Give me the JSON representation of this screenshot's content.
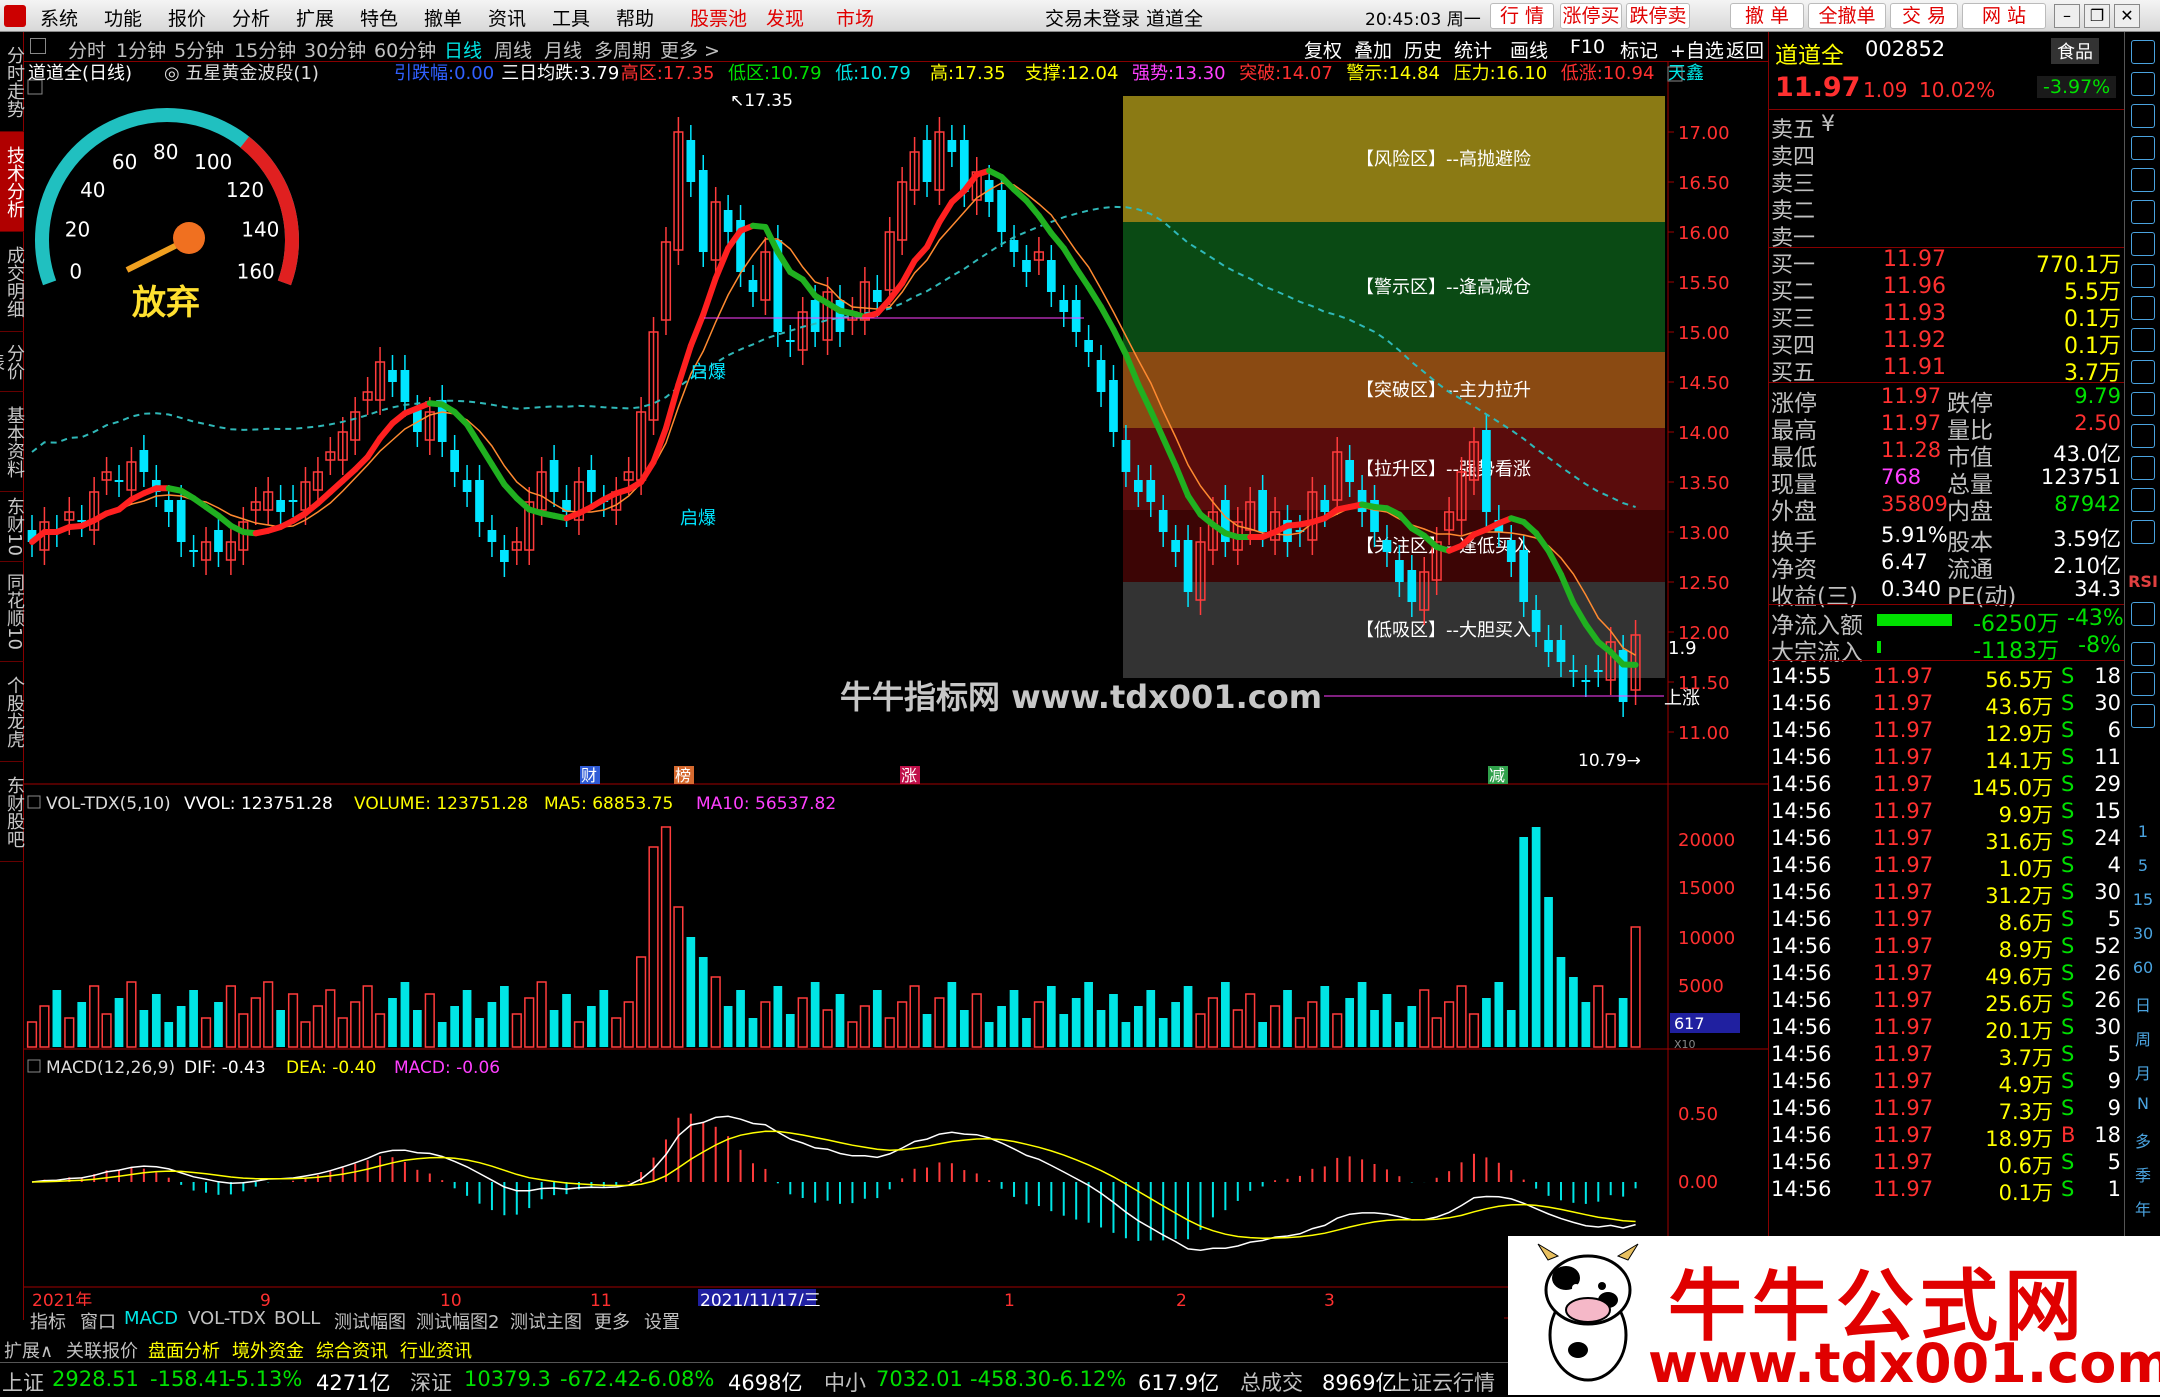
{
  "menu": {
    "items": [
      "系统",
      "功能",
      "报价",
      "分析",
      "扩展",
      "特色",
      "撤单",
      "资讯",
      "工具",
      "帮助"
    ],
    "red_items": [
      "股票池",
      "发现",
      "市场"
    ],
    "title": "交易未登录  道道全",
    "clock": "20:45:03 周一",
    "right_buttons": [
      "行 情",
      "涨停买",
      "跌停卖",
      "撤 单",
      "全撤单",
      "交 易",
      "网 站"
    ]
  },
  "side_tabs": [
    "分时走势",
    "技术分析",
    "成交明细",
    "分价表",
    "基本资料",
    "东财10",
    "同花顺10",
    "个股龙虎",
    "东财股吧"
  ],
  "period_bar": {
    "periods": [
      "分时",
      "1分钟",
      "5分钟",
      "15分钟",
      "30分钟",
      "60分钟",
      "日线",
      "周线",
      "月线",
      "多周期",
      "更多 >"
    ],
    "selected": "日线",
    "tools": [
      "复权",
      "叠加",
      "历史",
      "统计",
      "画线",
      "F10",
      "标记",
      "+自选",
      "返回"
    ]
  },
  "main_indicator": {
    "stock": "道道全(日线)",
    "formula": "五星黄金波段(1)",
    "values": [
      {
        "label": "引跌幅:",
        "value": "0.00",
        "color": "#3060ff"
      },
      {
        "label": "三日均跌:",
        "value": "3.79",
        "color": "#ffffff"
      },
      {
        "label": "高区:",
        "value": "17.35",
        "color": "#ff3030"
      },
      {
        "label": "低区:",
        "value": "10.79",
        "color": "#00e000"
      },
      {
        "label": "低:",
        "value": "10.79",
        "color": "#00e5e5"
      },
      {
        "label": "高:",
        "value": "17.35",
        "color": "#ffff00"
      },
      {
        "label": "支撑:",
        "value": "12.04",
        "color": "#ffff00"
      },
      {
        "label": "强势:",
        "value": "13.30",
        "color": "#ff40ff"
      },
      {
        "label": "突破:",
        "value": "14.07",
        "color": "#ff3030"
      },
      {
        "label": "警示:",
        "value": "14.84",
        "color": "#ffff00"
      },
      {
        "label": "压力:",
        "value": "16.10",
        "color": "#ffff00"
      },
      {
        "label": "低涨:",
        "value": "10.94",
        "color": "#ff3030"
      },
      {
        "label": "天鑫",
        "value": "",
        "color": "#00e5e5"
      }
    ]
  },
  "gauge": {
    "ticks": [
      "0",
      "20",
      "40",
      "60",
      "80",
      "100",
      "120",
      "140",
      "160"
    ],
    "status": "放弃"
  },
  "zones": [
    {
      "label": "【风险区】--高抛避险",
      "color": "#8b7a14"
    },
    {
      "label": "【警示区】--逢高减仓",
      "color": "#0a4a14"
    },
    {
      "label": "【突破区】--主力拉升",
      "color": "#8a4a12"
    },
    {
      "label": "【拉升区】--强势看涨",
      "color": "#5a0c0c"
    },
    {
      "label": "【关注区】--逢低买入",
      "color": "#3c0505"
    },
    {
      "label": "【低吸区】--大胆买入",
      "color": "#333333"
    }
  ],
  "price_axis": [
    "17.00",
    "16.50",
    "16.00",
    "15.50",
    "15.00",
    "14.50",
    "14.00",
    "13.50",
    "13.00",
    "12.50",
    "12.00",
    "11.50",
    "11.00"
  ],
  "annotations": {
    "high": "17.35",
    "low": "10.79",
    "qibao1": "启爆",
    "qibao2": "启爆",
    "right_val": "1.9",
    "right_lbl": "上涨",
    "markers": [
      "财",
      "榜",
      "涨",
      "减"
    ]
  },
  "watermark_chart": "牛牛指标网 www.tdx001.com",
  "vol": {
    "title": "VOL-TDX(5,10)",
    "vvol": "VVOL: 123751.28",
    "volume": "VOLUME: 123751.28",
    "ma5": "MA5: 68853.75",
    "ma10": "MA10: 56537.82",
    "axis": [
      "20000",
      "15000",
      "10000",
      "5000"
    ],
    "badge": "617",
    "badge2": "X10"
  },
  "macd": {
    "title": "MACD(12,26,9)",
    "dif": "DIF: -0.43",
    "dea": "DEA: -0.40",
    "macd": "MACD: -0.06",
    "axis": [
      "0.50",
      "0.00"
    ]
  },
  "date_axis": [
    "2021年",
    "9",
    "10",
    "11",
    "2021/11/17/三",
    "1",
    "2",
    "3"
  ],
  "bottom_tabs": [
    "指标",
    "窗口",
    "MACD",
    "VOL-TDX",
    "BOLL",
    "测试幅图",
    "测试幅图2",
    "测试主图",
    "更多",
    "设置"
  ],
  "bottom_tabs2": [
    "扩展∧",
    "关联报价",
    "盘面分析",
    "境外资金",
    "综合资讯",
    "行业资讯"
  ],
  "status": {
    "sh_name": "上证",
    "sh": "2928.51",
    "sh_chg": "-158.41",
    "sh_pct": "-5.13%",
    "sh_amt": "4271亿",
    "sz_name": "深证",
    "sz": "10379.3",
    "sz_chg": "-672.42",
    "sz_pct": "-6.08%",
    "sz_amt": "4698亿",
    "zx_name": "中小",
    "zx": "7032.01",
    "zx_chg": "-458.30",
    "zx_pct": "-6.12%",
    "zx_amt": "617.9亿",
    "total_lbl": "总成交",
    "total": "8969亿",
    "extra": "上证云行情"
  },
  "quote": {
    "name": "道道全",
    "code": "002852",
    "sector": "食品",
    "sector_pct": "-3.97%",
    "price": "11.97",
    "chg": "1.09",
    "pct": "10.02%",
    "sells": [
      {
        "l": "卖五",
        "p": "¥",
        "v": ""
      },
      {
        "l": "卖四",
        "p": "",
        "v": ""
      },
      {
        "l": "卖三",
        "p": "",
        "v": ""
      },
      {
        "l": "卖二",
        "p": "",
        "v": ""
      },
      {
        "l": "卖一",
        "p": "",
        "v": ""
      }
    ],
    "buys": [
      {
        "l": "买一",
        "p": "11.97",
        "v": "770.1万"
      },
      {
        "l": "买二",
        "p": "11.96",
        "v": "5.5万"
      },
      {
        "l": "买三",
        "p": "11.93",
        "v": "0.1万"
      },
      {
        "l": "买四",
        "p": "11.92",
        "v": "0.1万"
      },
      {
        "l": "买五",
        "p": "11.91",
        "v": "3.7万"
      }
    ],
    "stats": [
      {
        "a": "涨停",
        "b": "11.97",
        "c": "跌停",
        "d": "9.79",
        "bc": "#ff3030",
        "dc": "#00e000"
      },
      {
        "a": "最高",
        "b": "11.97",
        "c": "量比",
        "d": "2.50",
        "bc": "#ff3030",
        "dc": "#ff3030"
      },
      {
        "a": "最低",
        "b": "11.28",
        "c": "市值",
        "d": "43.0亿",
        "bc": "#ff3030",
        "dc": "#ffffff"
      },
      {
        "a": "现量",
        "b": "768",
        "c": "总量",
        "d": "123751",
        "bc": "#ff40ff",
        "dc": "#ffffff"
      },
      {
        "a": "外盘",
        "b": "35809",
        "c": "内盘",
        "d": "87942",
        "bc": "#ff3030",
        "dc": "#00e000"
      },
      {
        "a": "换手",
        "b": "5.91%",
        "c": "股本",
        "d": "3.59亿",
        "bc": "#ffffff",
        "dc": "#ffffff"
      },
      {
        "a": "净资",
        "b": "6.47",
        "c": "流通",
        "d": "2.10亿",
        "bc": "#ffffff",
        "dc": "#ffffff"
      },
      {
        "a": "收益(三)",
        "b": "0.340",
        "c": "PE(动)",
        "d": "34.3",
        "bc": "#ffffff",
        "dc": "#ffffff"
      }
    ],
    "flows": [
      {
        "l": "净流入额",
        "v": "-6250万",
        "p": "-43%",
        "fill": 0.75
      },
      {
        "l": "大宗流入",
        "v": "-1183万",
        "p": "-8%",
        "fill": 0.04
      }
    ],
    "ticks": [
      {
        "t": "14:55",
        "p": "11.97",
        "v": "56.5万",
        "s": "S",
        "n": "18"
      },
      {
        "t": "14:56",
        "p": "11.97",
        "v": "43.6万",
        "s": "S",
        "n": "30"
      },
      {
        "t": "14:56",
        "p": "11.97",
        "v": "12.9万",
        "s": "S",
        "n": "6"
      },
      {
        "t": "14:56",
        "p": "11.97",
        "v": "14.1万",
        "s": "S",
        "n": "11"
      },
      {
        "t": "14:56",
        "p": "11.97",
        "v": "145.0万",
        "s": "S",
        "n": "29"
      },
      {
        "t": "14:56",
        "p": "11.97",
        "v": "9.9万",
        "s": "S",
        "n": "15"
      },
      {
        "t": "14:56",
        "p": "11.97",
        "v": "31.6万",
        "s": "S",
        "n": "24"
      },
      {
        "t": "14:56",
        "p": "11.97",
        "v": "1.0万",
        "s": "S",
        "n": "4"
      },
      {
        "t": "14:56",
        "p": "11.97",
        "v": "31.2万",
        "s": "S",
        "n": "30"
      },
      {
        "t": "14:56",
        "p": "11.97",
        "v": "8.6万",
        "s": "S",
        "n": "5"
      },
      {
        "t": "14:56",
        "p": "11.97",
        "v": "8.9万",
        "s": "S",
        "n": "52"
      },
      {
        "t": "14:56",
        "p": "11.97",
        "v": "49.6万",
        "s": "S",
        "n": "26"
      },
      {
        "t": "14:56",
        "p": "11.97",
        "v": "25.6万",
        "s": "S",
        "n": "26"
      },
      {
        "t": "14:56",
        "p": "11.97",
        "v": "20.1万",
        "s": "S",
        "n": "30"
      },
      {
        "t": "14:56",
        "p": "11.97",
        "v": "3.7万",
        "s": "S",
        "n": "5"
      },
      {
        "t": "14:56",
        "p": "11.97",
        "v": "4.9万",
        "s": "S",
        "n": "9"
      },
      {
        "t": "14:56",
        "p": "11.97",
        "v": "7.3万",
        "s": "S",
        "n": "9"
      },
      {
        "t": "14:56",
        "p": "11.97",
        "v": "18.9万",
        "s": "B",
        "n": "18"
      },
      {
        "t": "14:56",
        "p": "11.97",
        "v": "0.6万",
        "s": "S",
        "n": "5"
      },
      {
        "t": "14:56",
        "p": "11.97",
        "v": "0.1万",
        "s": "S",
        "n": "1"
      }
    ]
  },
  "vtoolbar": {
    "labels": [
      "1",
      "5",
      "15",
      "30",
      "60",
      "日",
      "周",
      "月",
      "N",
      "多",
      "季",
      "年"
    ],
    "rsi": "RSI"
  },
  "watermark": {
    "line1": "牛牛公式网",
    "line2": "www.tdx001.com"
  }
}
